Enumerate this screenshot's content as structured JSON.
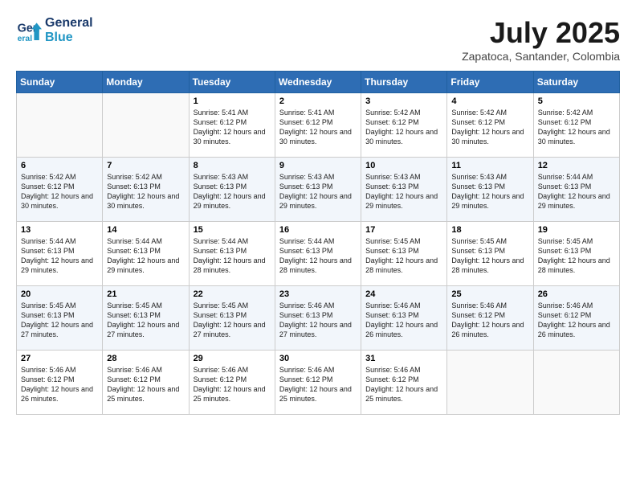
{
  "header": {
    "logo_line1": "General",
    "logo_line2": "Blue",
    "month_year": "July 2025",
    "location": "Zapatoca, Santander, Colombia"
  },
  "weekdays": [
    "Sunday",
    "Monday",
    "Tuesday",
    "Wednesday",
    "Thursday",
    "Friday",
    "Saturday"
  ],
  "weeks": [
    [
      {
        "day": "",
        "info": ""
      },
      {
        "day": "",
        "info": ""
      },
      {
        "day": "1",
        "info": "Sunrise: 5:41 AM\nSunset: 6:12 PM\nDaylight: 12 hours and 30 minutes."
      },
      {
        "day": "2",
        "info": "Sunrise: 5:41 AM\nSunset: 6:12 PM\nDaylight: 12 hours and 30 minutes."
      },
      {
        "day": "3",
        "info": "Sunrise: 5:42 AM\nSunset: 6:12 PM\nDaylight: 12 hours and 30 minutes."
      },
      {
        "day": "4",
        "info": "Sunrise: 5:42 AM\nSunset: 6:12 PM\nDaylight: 12 hours and 30 minutes."
      },
      {
        "day": "5",
        "info": "Sunrise: 5:42 AM\nSunset: 6:12 PM\nDaylight: 12 hours and 30 minutes."
      }
    ],
    [
      {
        "day": "6",
        "info": "Sunrise: 5:42 AM\nSunset: 6:12 PM\nDaylight: 12 hours and 30 minutes."
      },
      {
        "day": "7",
        "info": "Sunrise: 5:42 AM\nSunset: 6:13 PM\nDaylight: 12 hours and 30 minutes."
      },
      {
        "day": "8",
        "info": "Sunrise: 5:43 AM\nSunset: 6:13 PM\nDaylight: 12 hours and 29 minutes."
      },
      {
        "day": "9",
        "info": "Sunrise: 5:43 AM\nSunset: 6:13 PM\nDaylight: 12 hours and 29 minutes."
      },
      {
        "day": "10",
        "info": "Sunrise: 5:43 AM\nSunset: 6:13 PM\nDaylight: 12 hours and 29 minutes."
      },
      {
        "day": "11",
        "info": "Sunrise: 5:43 AM\nSunset: 6:13 PM\nDaylight: 12 hours and 29 minutes."
      },
      {
        "day": "12",
        "info": "Sunrise: 5:44 AM\nSunset: 6:13 PM\nDaylight: 12 hours and 29 minutes."
      }
    ],
    [
      {
        "day": "13",
        "info": "Sunrise: 5:44 AM\nSunset: 6:13 PM\nDaylight: 12 hours and 29 minutes."
      },
      {
        "day": "14",
        "info": "Sunrise: 5:44 AM\nSunset: 6:13 PM\nDaylight: 12 hours and 29 minutes."
      },
      {
        "day": "15",
        "info": "Sunrise: 5:44 AM\nSunset: 6:13 PM\nDaylight: 12 hours and 28 minutes."
      },
      {
        "day": "16",
        "info": "Sunrise: 5:44 AM\nSunset: 6:13 PM\nDaylight: 12 hours and 28 minutes."
      },
      {
        "day": "17",
        "info": "Sunrise: 5:45 AM\nSunset: 6:13 PM\nDaylight: 12 hours and 28 minutes."
      },
      {
        "day": "18",
        "info": "Sunrise: 5:45 AM\nSunset: 6:13 PM\nDaylight: 12 hours and 28 minutes."
      },
      {
        "day": "19",
        "info": "Sunrise: 5:45 AM\nSunset: 6:13 PM\nDaylight: 12 hours and 28 minutes."
      }
    ],
    [
      {
        "day": "20",
        "info": "Sunrise: 5:45 AM\nSunset: 6:13 PM\nDaylight: 12 hours and 27 minutes."
      },
      {
        "day": "21",
        "info": "Sunrise: 5:45 AM\nSunset: 6:13 PM\nDaylight: 12 hours and 27 minutes."
      },
      {
        "day": "22",
        "info": "Sunrise: 5:45 AM\nSunset: 6:13 PM\nDaylight: 12 hours and 27 minutes."
      },
      {
        "day": "23",
        "info": "Sunrise: 5:46 AM\nSunset: 6:13 PM\nDaylight: 12 hours and 27 minutes."
      },
      {
        "day": "24",
        "info": "Sunrise: 5:46 AM\nSunset: 6:13 PM\nDaylight: 12 hours and 26 minutes."
      },
      {
        "day": "25",
        "info": "Sunrise: 5:46 AM\nSunset: 6:12 PM\nDaylight: 12 hours and 26 minutes."
      },
      {
        "day": "26",
        "info": "Sunrise: 5:46 AM\nSunset: 6:12 PM\nDaylight: 12 hours and 26 minutes."
      }
    ],
    [
      {
        "day": "27",
        "info": "Sunrise: 5:46 AM\nSunset: 6:12 PM\nDaylight: 12 hours and 26 minutes."
      },
      {
        "day": "28",
        "info": "Sunrise: 5:46 AM\nSunset: 6:12 PM\nDaylight: 12 hours and 25 minutes."
      },
      {
        "day": "29",
        "info": "Sunrise: 5:46 AM\nSunset: 6:12 PM\nDaylight: 12 hours and 25 minutes."
      },
      {
        "day": "30",
        "info": "Sunrise: 5:46 AM\nSunset: 6:12 PM\nDaylight: 12 hours and 25 minutes."
      },
      {
        "day": "31",
        "info": "Sunrise: 5:46 AM\nSunset: 6:12 PM\nDaylight: 12 hours and 25 minutes."
      },
      {
        "day": "",
        "info": ""
      },
      {
        "day": "",
        "info": ""
      }
    ]
  ]
}
